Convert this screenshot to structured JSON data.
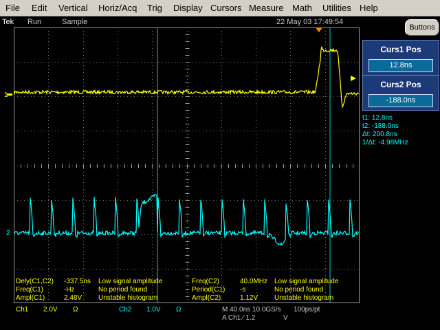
{
  "menu": {
    "items": [
      "File",
      "Edit",
      "Vertical",
      "Horiz/Acq",
      "Trig",
      "Display",
      "Cursors",
      "Measure",
      "Math",
      "Utilities",
      "Help"
    ]
  },
  "status": {
    "brand": "Tek",
    "state": "Run",
    "mode": "Sample",
    "datetime": "22 May 03 17:49:54"
  },
  "buttons_label": "Buttons",
  "markers": {
    "ch1": "1",
    "ch2": "2"
  },
  "cursor_panel": {
    "curs1_title": "Curs1 Pos",
    "curs1_value": "12.8ns",
    "curs2_title": "Curs2 Pos",
    "curs2_value": "-188.0ns",
    "t1": "t1: 12.8ns",
    "t2": "t2: -188.0ns",
    "dt": "Δt: 200.8ns",
    "inv_dt": "1/Δt: -4.98MHz"
  },
  "measurements": {
    "left": [
      {
        "name": "Dely(C1,C2)",
        "value": "-337.5ns",
        "status": "Low signal amplitude"
      },
      {
        "name": "Freq(C1)",
        "value": "-Hz",
        "status": "No period found"
      },
      {
        "name": "Ampl(C1)",
        "value": "2.48V",
        "status": "Unstable histogram"
      }
    ],
    "right": [
      {
        "name": "Freq(C2)",
        "value": "40.0MHz",
        "status": "Low signal amplitude"
      },
      {
        "name": "Period(C1)",
        "value": "-s",
        "status": "No period found"
      },
      {
        "name": "Ampl(C2)",
        "value": "1.12V",
        "status": "Unstable histogram"
      }
    ]
  },
  "bottom": {
    "ch1_label": "Ch1",
    "ch1_scale": "2.0V",
    "ch1_coupling": "Ω",
    "ch2_label": "Ch2",
    "ch2_scale": "1.0V",
    "ch2_coupling": "Ω",
    "timebase": "M 40.0ns 10.0GS/s",
    "pts": "100ps/pt",
    "trigger": "A  Ch1  ⁄  1.2",
    "trigger_unit": "V"
  },
  "colors": {
    "ch1": "#ffff00",
    "ch2": "#00ffff",
    "grid": "#808080",
    "panel": "#1c3a78",
    "menu_bg": "#d4d0c8"
  }
}
